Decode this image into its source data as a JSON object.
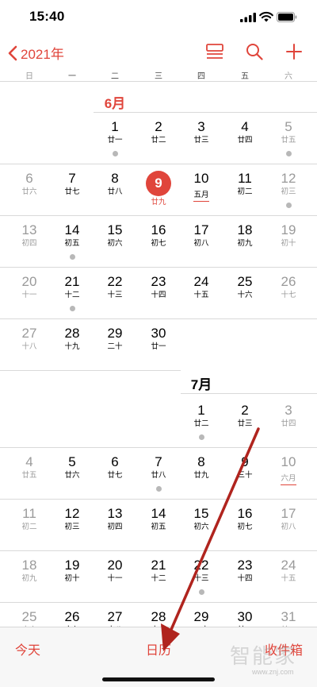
{
  "status": {
    "time": "15:40"
  },
  "nav": {
    "back_label": "2021年"
  },
  "weekdays": [
    "日",
    "一",
    "二",
    "三",
    "四",
    "五",
    "六"
  ],
  "months": [
    {
      "label": "6月"
    },
    {
      "label": "7月"
    }
  ],
  "june": {
    "weeks": [
      [
        null,
        {
          "n": "1",
          "l": "廿一",
          "dot": true
        },
        {
          "n": "2",
          "l": "廿二"
        },
        {
          "n": "3",
          "l": "廿三"
        },
        {
          "n": "4",
          "l": "廿四"
        },
        {
          "n": "5",
          "l": "廿五",
          "dot": true
        }
      ],
      [
        {
          "n": "6",
          "l": "廿六"
        },
        {
          "n": "7",
          "l": "廿七"
        },
        {
          "n": "8",
          "l": "廿八"
        },
        {
          "n": "9",
          "l": "廿九",
          "today": true
        },
        {
          "n": "10",
          "l": "五月",
          "festival": true
        },
        {
          "n": "11",
          "l": "初二"
        },
        {
          "n": "12",
          "l": "初三",
          "dot": true
        }
      ],
      [
        {
          "n": "13",
          "l": "初四"
        },
        {
          "n": "14",
          "l": "初五",
          "dot": true
        },
        {
          "n": "15",
          "l": "初六"
        },
        {
          "n": "16",
          "l": "初七"
        },
        {
          "n": "17",
          "l": "初八"
        },
        {
          "n": "18",
          "l": "初九"
        },
        {
          "n": "19",
          "l": "初十"
        }
      ],
      [
        {
          "n": "20",
          "l": "十一"
        },
        {
          "n": "21",
          "l": "十二",
          "dot": true
        },
        {
          "n": "22",
          "l": "十三"
        },
        {
          "n": "23",
          "l": "十四"
        },
        {
          "n": "24",
          "l": "十五"
        },
        {
          "n": "25",
          "l": "十六"
        },
        {
          "n": "26",
          "l": "十七"
        }
      ],
      [
        {
          "n": "27",
          "l": "十八"
        },
        {
          "n": "28",
          "l": "十九"
        },
        {
          "n": "29",
          "l": "二十"
        },
        {
          "n": "30",
          "l": "廿一"
        }
      ]
    ]
  },
  "july": {
    "weeks": [
      [
        {
          "col": 4,
          "n": "1",
          "l": "廿二",
          "dot": true
        },
        {
          "col": 5,
          "n": "2",
          "l": "廿三"
        },
        {
          "col": 6,
          "n": "3",
          "l": "廿四"
        }
      ],
      [
        {
          "n": "4",
          "l": "廿五"
        },
        {
          "n": "5",
          "l": "廿六"
        },
        {
          "n": "6",
          "l": "廿七"
        },
        {
          "n": "7",
          "l": "廿八",
          "dot": true
        },
        {
          "n": "8",
          "l": "廿九"
        },
        {
          "n": "9",
          "l": "三十"
        },
        {
          "n": "10",
          "l": "六月",
          "festival": true
        }
      ],
      [
        {
          "n": "11",
          "l": "初二"
        },
        {
          "n": "12",
          "l": "初三"
        },
        {
          "n": "13",
          "l": "初四"
        },
        {
          "n": "14",
          "l": "初五"
        },
        {
          "n": "15",
          "l": "初六"
        },
        {
          "n": "16",
          "l": "初七"
        },
        {
          "n": "17",
          "l": "初八"
        }
      ],
      [
        {
          "n": "18",
          "l": "初九"
        },
        {
          "n": "19",
          "l": "初十"
        },
        {
          "n": "20",
          "l": "十一"
        },
        {
          "n": "21",
          "l": "十二"
        },
        {
          "n": "22",
          "l": "十三",
          "dot": true
        },
        {
          "n": "23",
          "l": "十四"
        },
        {
          "n": "24",
          "l": "十五"
        }
      ],
      [
        {
          "n": "25",
          "l": "十六"
        },
        {
          "n": "26",
          "l": "十七"
        },
        {
          "n": "27",
          "l": "十八"
        },
        {
          "n": "28",
          "l": "十九"
        },
        {
          "n": "29",
          "l": "二十"
        },
        {
          "n": "30",
          "l": "廿一"
        },
        {
          "n": "31",
          "l": "廿二"
        }
      ]
    ]
  },
  "tabs": {
    "today": "今天",
    "calendar": "日历",
    "inbox": "收件箱"
  },
  "watermark": {
    "text": "智能家",
    "url": "www.znj.com"
  },
  "colors": {
    "accent": "#e0453b",
    "weekend": "#9a9a9a",
    "dot": "#b8b8b8"
  },
  "annotation": {
    "type": "arrow",
    "color": "#b0241e",
    "points_to": "日历"
  }
}
